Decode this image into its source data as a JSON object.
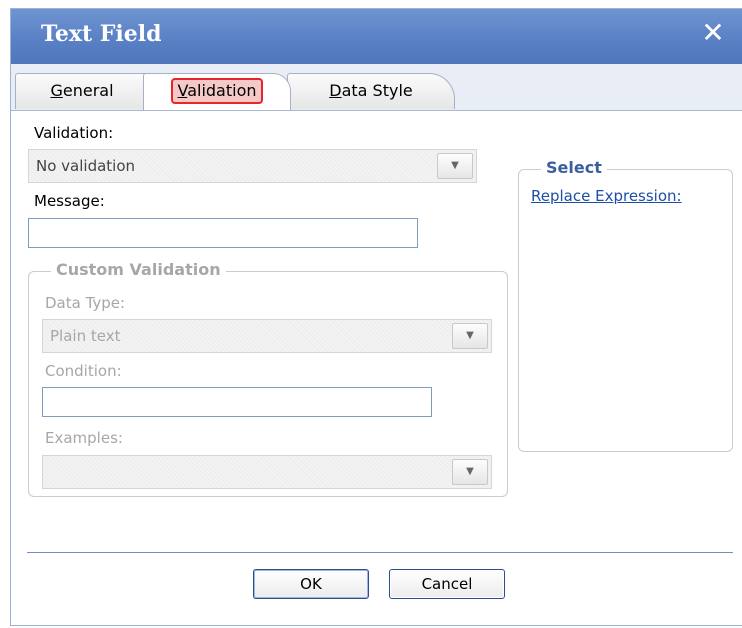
{
  "dialog": {
    "title": "Text Field",
    "close_glyph": "✕"
  },
  "tabs": {
    "general_accel": "G",
    "general_rest": "eneral",
    "validation_accel": "V",
    "validation_rest": "alidation",
    "datastyle_accel": "D",
    "datastyle_rest": "ata Style",
    "active": "Validation",
    "highlight_color": "#e8262a"
  },
  "form": {
    "validation_label": "Validation:",
    "validation_value": "No validation",
    "message_label": "Message:",
    "message_value": ""
  },
  "custom_validation": {
    "legend": "Custom Validation",
    "data_type_label": "Data Type:",
    "data_type_value": "Plain text",
    "condition_label": "Condition:",
    "condition_value": "",
    "examples_label": "Examples:",
    "examples_value": ""
  },
  "select_panel": {
    "legend": "Select",
    "link": "Replace Expression:"
  },
  "buttons": {
    "ok": "OK",
    "cancel": "Cancel"
  },
  "colors": {
    "titlebar": "#5a81c5",
    "link": "#1d4ea8",
    "disabled_text": "#a7a7a7"
  }
}
